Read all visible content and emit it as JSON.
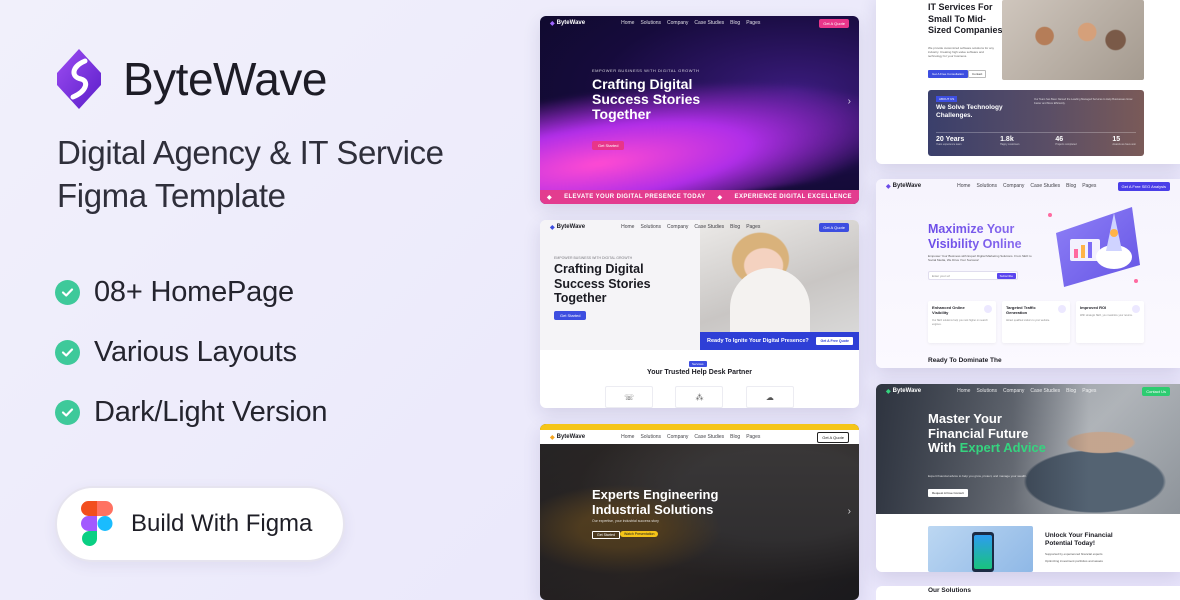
{
  "brand": {
    "name": "ByteWave"
  },
  "headline": {
    "line1": "Digital Agency & IT Service",
    "line2": "Figma Template"
  },
  "features": [
    {
      "label": "08+ HomePage"
    },
    {
      "label": "Various Layouts"
    },
    {
      "label": "Dark/Light Version"
    }
  ],
  "figma_button": {
    "label": "Build With Figma"
  },
  "colors": {
    "accent": "#7b2fe0",
    "check": "#3ec99a",
    "pink": "#e33c8f",
    "blue": "#3d4ee0",
    "green": "#35d47f",
    "yellow": "#f5c518"
  },
  "previews": {
    "p1": {
      "logo": "ByteWave",
      "nav": [
        "Home",
        "Solutions",
        "Company",
        "Case Studies",
        "Blog",
        "Pages"
      ],
      "cta": "Get A Quote",
      "eyebrow": "EMPOWER BUSINESS WITH DIGITAL GROWTH",
      "title": "Crafting Digital Success Stories Together",
      "button": "Get Started",
      "ticker1": "ELEVATE YOUR DIGITAL PRESENCE TODAY",
      "ticker2": "EXPERIENCE DIGITAL EXCELLENCE"
    },
    "p2": {
      "logo": "ByteWave",
      "nav": [
        "Home",
        "Solutions",
        "Company",
        "Case Studies",
        "Blog",
        "Pages"
      ],
      "cta": "Get A Quote",
      "eyebrow": "EMPOWER BUSINESS WITH DIGITAL GROWTH",
      "title": "Crafting Digital Success Stories Together",
      "button": "Get Started",
      "band": "Ready To Ignite Your Digital Presence?",
      "band_button": "Get A Free Quote",
      "tag": "Services",
      "subtitle": "Your Trusted Help Desk Partner"
    },
    "p3": {
      "logo": "ByteWave",
      "nav": [
        "Home",
        "Solutions",
        "Company",
        "Case Studies",
        "Blog",
        "Pages"
      ],
      "cta": "Get A Quote",
      "title": "Experts Engineering Industrial Solutions",
      "desc": "Our expertise, your industrial success story",
      "button1": "Get Started",
      "button2": "Watch Presentation"
    },
    "p4": {
      "title": "IT Services For Small To Mid-Sized Companies",
      "desc": "We provide customized software solutions for any industry. Creating high-value software and technology for your business.",
      "button1": "Get A Free Consultation",
      "button2": "Contact",
      "dark_tag": "ABOUT US",
      "dark_title": "We Solve Technology Challenges.",
      "dark_desc": "Our Team has Been Named the Leading Managed Services to Help Businesses Grow Faster and More Efficiently.",
      "stats": [
        {
          "value": "20 Years",
          "label": "Years experience team"
        },
        {
          "value": "1.8k",
          "label": "Happy customers"
        },
        {
          "value": "46",
          "label": "Projects completed"
        },
        {
          "value": "15",
          "label": "Awards we have won"
        }
      ]
    },
    "p5": {
      "logo": "ByteWave",
      "nav": [
        "Home",
        "Solutions",
        "Company",
        "Case Studies",
        "Blog",
        "Pages"
      ],
      "cta": "Get A Free SEO Analysis",
      "title": "Maximize Your Visibility Online",
      "desc": "Empower Your Business with Expert Digital Marketing Solutions. From SEO to Social Media, We Drive Your Success!",
      "search_placeholder": "Enter your url",
      "search_button": "Subscribe",
      "features": [
        {
          "title": "Enhanced Online Visibility",
          "desc": "Our SEO solutions help you rank higher on search engines."
        },
        {
          "title": "Targeted Traffic Generation",
          "desc": "Attract qualified visitors to your website."
        },
        {
          "title": "Improved ROI",
          "desc": "With strategic SEO, you maximize your returns."
        }
      ],
      "bottom": "Ready To Dominate The"
    },
    "p6": {
      "logo": "ByteWave",
      "nav": [
        "Home",
        "Solutions",
        "Company",
        "Case Studies",
        "Blog",
        "Pages"
      ],
      "cta": "Contact Us",
      "title_1": "Master Your Financial Future With",
      "title_2": "Expert Advice",
      "desc": "Expert financial advice to help you grow, protect, and manage your wealth.",
      "button": "Request A Free Consult",
      "unlock": "Unlock Your Financial Potential Today!",
      "list": [
        "Supported by experienced financial experts",
        "Optimizing investment portfolios and assets"
      ],
      "solutions": "Our Solutions"
    }
  }
}
